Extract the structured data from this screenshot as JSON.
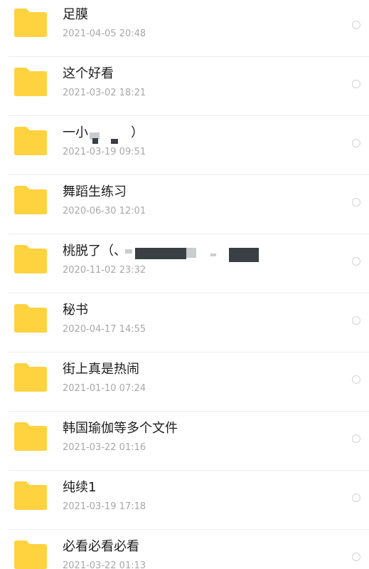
{
  "folder_color": "#FFD23F",
  "items": [
    {
      "name": "足膜",
      "date": "2021-04-05 20:48"
    },
    {
      "name": "这个好看",
      "date": "2021-03-02 18:21"
    },
    {
      "name": "一小",
      "name_suffix": "）",
      "date": "2021-03-19 09:51"
    },
    {
      "name": "舞蹈生练习",
      "date": "2020-06-30 12:01"
    },
    {
      "name": "桃脱了（、",
      "date": "2020-11-02 23:32"
    },
    {
      "name": "秘书",
      "date": "2020-04-17 14:55"
    },
    {
      "name": "街上真是热闹",
      "date": "2021-01-10 07:24"
    },
    {
      "name": "韩国瑜伽等多个文件",
      "date": "2021-03-22 01:16"
    },
    {
      "name": "纯续1",
      "date": "2021-03-19 17:18"
    },
    {
      "name": "必看必看必看",
      "date": "2021-03-22 01:13"
    }
  ]
}
